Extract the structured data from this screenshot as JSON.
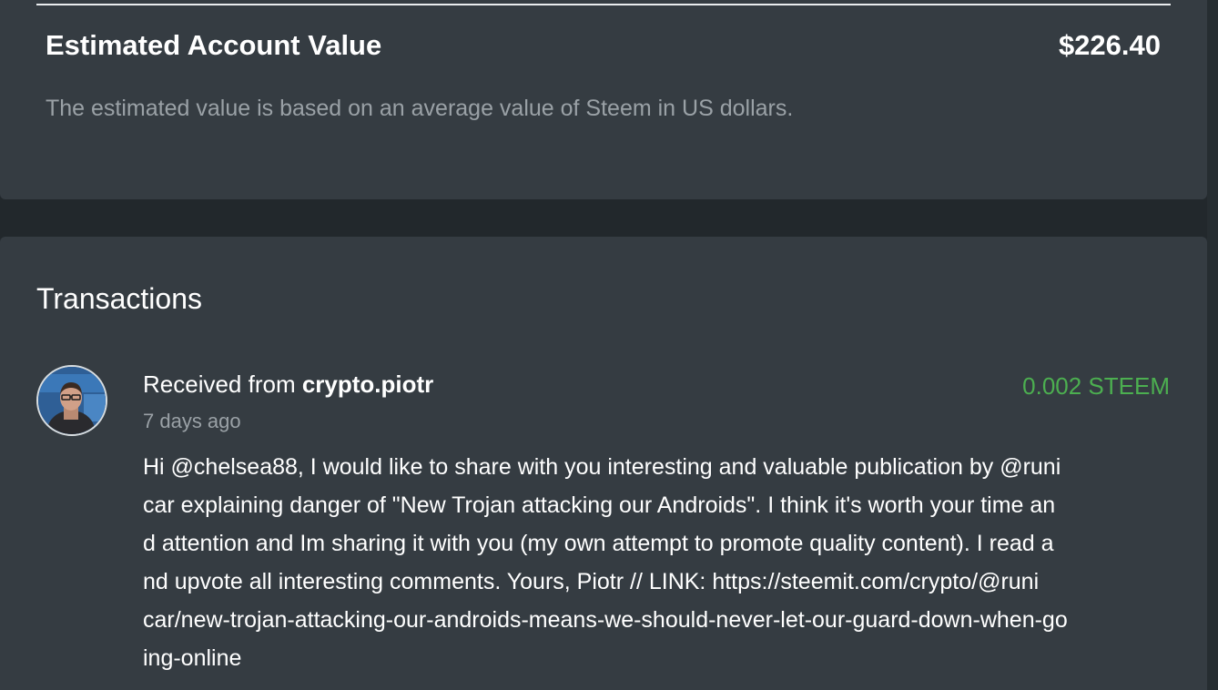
{
  "account_value": {
    "title": "Estimated Account Value",
    "amount": "$226.40",
    "description": "The estimated value is based on an average value of Steem in US dollars."
  },
  "transactions": {
    "heading": "Transactions",
    "items": [
      {
        "avatar_icon": "user-avatar",
        "prefix": "Received from ",
        "sender": "crypto.piotr",
        "amount": "0.002 STEEM",
        "amount_color": "#4caf50",
        "time": "7 days ago",
        "memo_lines": [
          "Hi @chelsea88, I would like to share with you interesting and valuable publication by @runi",
          "car explaining danger of \"New Trojan attacking our Androids\". I think it's worth your time an",
          "d attention and Im sharing it with you (my own attempt to promote quality content). I read a",
          "nd upvote all interesting comments. Yours, Piotr // LINK: https://steemit.com/crypto/@runi",
          "car/new-trojan-attacking-our-androids-means-we-should-never-let-our-guard-down-when-go",
          "ing-online"
        ]
      }
    ]
  },
  "colors": {
    "background": "#22282c",
    "card": "#353c42",
    "muted_text": "#9aa1a6",
    "positive": "#4caf50"
  }
}
